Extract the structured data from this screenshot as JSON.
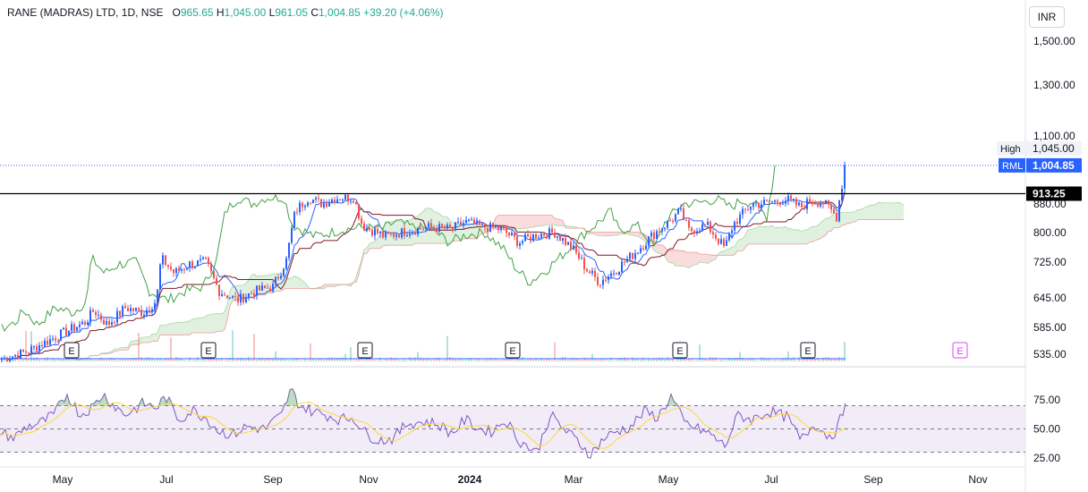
{
  "legend": {
    "title": "RANE (MADRAS) LTD, 1D, NSE",
    "o_label": "O",
    "o_value": "965.65",
    "h_label": "H",
    "h_value": "1,045.00",
    "l_label": "L",
    "l_value": "961.05",
    "c_label": "C",
    "c_value": "1,004.85",
    "change": "+39.20 (+4.06%)"
  },
  "currency": "INR",
  "colors": {
    "up": "#2962ff",
    "down": "#ef5350",
    "tenkan": "#2962ff",
    "kijun": "#801922",
    "chikou": "#43a047",
    "cloud_bull": "#a5d6a7",
    "cloud_bear": "#ef9a9a",
    "rsi": "#7e57c2",
    "rsi_ma": "#fdd835",
    "rsi_band": "#ede7f6",
    "hline": "#000000",
    "earnings": "#131722",
    "earnings_future": "#e040fb"
  },
  "chart_data": [
    {
      "type": "candlestick",
      "symbol": "RANE (MADRAS) LTD",
      "interval": "1D",
      "exchange": "NSE",
      "y_ticks": [
        "1,500.00",
        "1,300.00",
        "1,100.00",
        "880.00",
        "800.00",
        "725.00",
        "645.00",
        "585.00",
        "535.00"
      ],
      "y_tick_values": [
        1500,
        1300,
        1100,
        880,
        800,
        725,
        645,
        585,
        535
      ],
      "x_ticks": [
        "May",
        "Jul",
        "Sep",
        "Nov",
        "2024",
        "Mar",
        "May",
        "Jul",
        "Sep",
        "Nov"
      ],
      "price_labels": [
        {
          "label": "High",
          "value": "1,045.00"
        },
        {
          "label": "RML",
          "value": "1,004.85"
        },
        {
          "label": "",
          "value": "913.25"
        }
      ],
      "horizontal_line": 913.25,
      "earnings_marker": "E",
      "earnings_count": 7,
      "future_earnings_count": 1,
      "price_points": [
        [
          0,
          525
        ],
        [
          30,
          540
        ],
        [
          95,
          595
        ],
        [
          105,
          620
        ],
        [
          120,
          590
        ],
        [
          140,
          625
        ],
        [
          160,
          615
        ],
        [
          175,
          640
        ],
        [
          180,
          735
        ],
        [
          195,
          700
        ],
        [
          210,
          720
        ],
        [
          230,
          725
        ],
        [
          245,
          660
        ],
        [
          265,
          640
        ],
        [
          285,
          660
        ],
        [
          305,
          670
        ],
        [
          320,
          730
        ],
        [
          330,
          860
        ],
        [
          345,
          900
        ],
        [
          360,
          880
        ],
        [
          375,
          900
        ],
        [
          395,
          900
        ],
        [
          405,
          820
        ],
        [
          430,
          790
        ],
        [
          455,
          805
        ],
        [
          480,
          815
        ],
        [
          505,
          810
        ],
        [
          520,
          830
        ],
        [
          540,
          815
        ],
        [
          560,
          810
        ],
        [
          580,
          775
        ],
        [
          600,
          795
        ],
        [
          620,
          800
        ],
        [
          640,
          760
        ],
        [
          655,
          710
        ],
        [
          670,
          680
        ],
        [
          690,
          710
        ],
        [
          710,
          750
        ],
        [
          730,
          795
        ],
        [
          750,
          835
        ],
        [
          760,
          860
        ],
        [
          770,
          805
        ],
        [
          790,
          820
        ],
        [
          810,
          760
        ],
        [
          820,
          825
        ],
        [
          840,
          880
        ],
        [
          860,
          885
        ],
        [
          880,
          895
        ],
        [
          895,
          870
        ],
        [
          905,
          890
        ],
        [
          920,
          885
        ],
        [
          935,
          845
        ],
        [
          945,
          1004.85
        ]
      ]
    },
    {
      "type": "line",
      "name": "RSI",
      "y_ticks": [
        "75.00",
        "50.00",
        "25.00"
      ],
      "y_tick_values": [
        75,
        50,
        25
      ],
      "bands": [
        70,
        50,
        30
      ],
      "rsi_points": [
        [
          0,
          48
        ],
        [
          15,
          42
        ],
        [
          30,
          52
        ],
        [
          45,
          55
        ],
        [
          60,
          62
        ],
        [
          75,
          80
        ],
        [
          90,
          62
        ],
        [
          105,
          70
        ],
        [
          115,
          80
        ],
        [
          125,
          72
        ],
        [
          140,
          62
        ],
        [
          160,
          72
        ],
        [
          175,
          68
        ],
        [
          185,
          78
        ],
        [
          200,
          58
        ],
        [
          215,
          66
        ],
        [
          230,
          60
        ],
        [
          245,
          48
        ],
        [
          260,
          45
        ],
        [
          275,
          52
        ],
        [
          295,
          50
        ],
        [
          315,
          62
        ],
        [
          325,
          84
        ],
        [
          335,
          70
        ],
        [
          350,
          65
        ],
        [
          365,
          62
        ],
        [
          380,
          58
        ],
        [
          395,
          60
        ],
        [
          410,
          45
        ],
        [
          425,
          40
        ],
        [
          440,
          42
        ],
        [
          455,
          55
        ],
        [
          475,
          56
        ],
        [
          490,
          54
        ],
        [
          505,
          46
        ],
        [
          520,
          58
        ],
        [
          535,
          50
        ],
        [
          550,
          48
        ],
        [
          565,
          58
        ],
        [
          580,
          40
        ],
        [
          600,
          30
        ],
        [
          615,
          62
        ],
        [
          630,
          50
        ],
        [
          645,
          40
        ],
        [
          660,
          28
        ],
        [
          675,
          42
        ],
        [
          690,
          48
        ],
        [
          705,
          52
        ],
        [
          720,
          65
        ],
        [
          735,
          60
        ],
        [
          750,
          78
        ],
        [
          765,
          55
        ],
        [
          780,
          50
        ],
        [
          795,
          45
        ],
        [
          810,
          35
        ],
        [
          825,
          62
        ],
        [
          840,
          58
        ],
        [
          860,
          65
        ],
        [
          880,
          60
        ],
        [
          895,
          40
        ],
        [
          910,
          55
        ],
        [
          925,
          44
        ],
        [
          935,
          48
        ],
        [
          945,
          72
        ]
      ]
    }
  ]
}
